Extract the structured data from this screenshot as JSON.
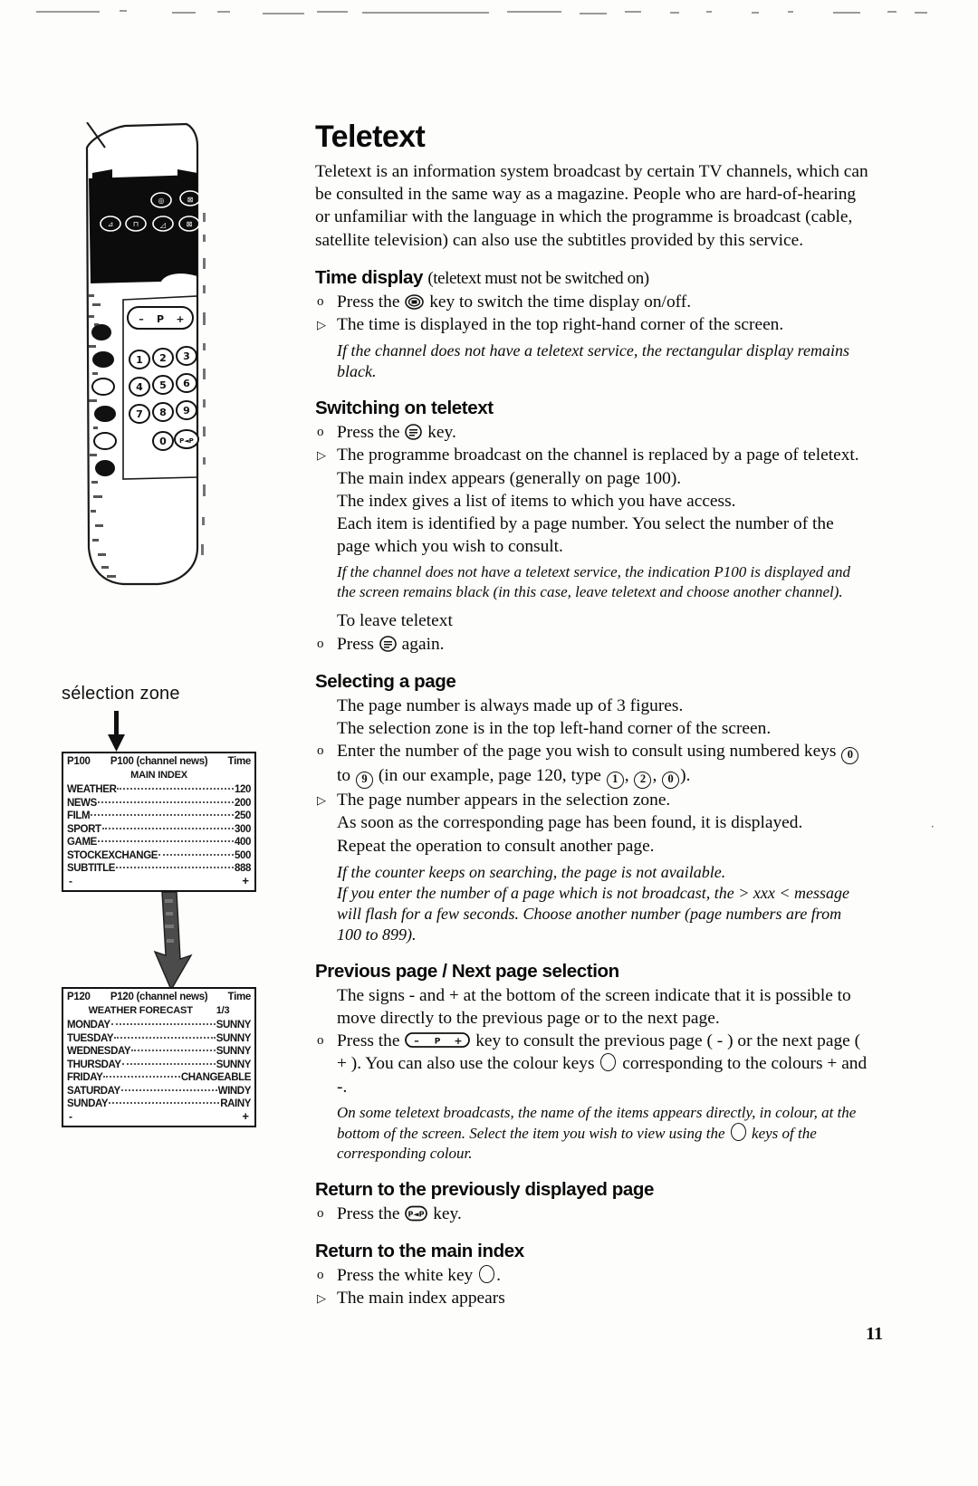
{
  "document": {
    "title": "Teletext",
    "page_number": "11",
    "intro": "Teletext is an information system broadcast by certain TV channels, which can be consulted in the same way as a magazine. People who are hard-of-hearing or unfamiliar with the language in which the programme is broadcast (cable, satellite television) can also use the subtitles provided by this service."
  },
  "sections": {
    "time_display": {
      "heading": "Time display",
      "heading_note": "(teletext must not be switched on)",
      "bullet_press_pre": "Press the",
      "bullet_press_post": "key to switch the time display on/off.",
      "result": "The time is displayed in the top right-hand corner of the screen.",
      "note": "If the channel does not have a teletext service, the rectangular display remains black."
    },
    "switching_on": {
      "heading": "Switching on teletext",
      "bullet_press_pre": "Press the",
      "bullet_press_post": "key.",
      "result_1": "The programme broadcast on the channel is replaced by a page of teletext. The main index appears (generally on page 100).",
      "result_2": "The index gives a list of items to which you have access.",
      "result_3": "Each item is identified by a page number. You select the number of the page which you wish to consult.",
      "note": "If the channel does not have a teletext service, the indication P100 is displayed and the screen remains black (in this case, leave teletext and choose another channel).",
      "leave_label": "To leave teletext",
      "leave_pre": "Press",
      "leave_post": "again."
    },
    "selecting_page": {
      "heading": "Selecting a page",
      "line_1": "The page number is always made up of 3 figures.",
      "line_2": "The selection zone is in the top left-hand corner of the screen.",
      "bullet_pre": "Enter the number of the page you wish to consult using numbered keys",
      "bullet_mid": "to",
      "bullet_post": "(in our example, page 120, type",
      "bullet_end": ").",
      "key_from": "0",
      "key_to": "9",
      "example_keys": [
        "1",
        "2",
        "0"
      ],
      "result_1": "The page number appears in the selection zone.",
      "result_2": "As soon as the corresponding page has been found, it is displayed.",
      "result_3": "Repeat the operation to consult another page.",
      "note_1": "If the counter keeps on searching, the page is not available.",
      "note_2": "If you enter the number of a page which is not broadcast, the > xxx < message will flash for a few seconds. Choose another number (page numbers are from 100 to 899)."
    },
    "prev_next": {
      "heading": "Previous page / Next page selection",
      "line_1": "The signs - and + at the bottom of the screen indicate that it is possible to move directly to the previous page or to the next page.",
      "bullet_pre": "Press the",
      "bullet_mid": "key to consult the previous page ( - ) or the next page ( + ). You can also use the colour keys",
      "bullet_post": "corresponding to the colours + and -.",
      "note_pre": "On some teletext broadcasts, the name of the items appears directly, in colour, at the bottom of the screen. Select the item you wish to view using the",
      "note_post": "keys of the corresponding colour."
    },
    "return_previous": {
      "heading": "Return to the previously displayed page",
      "bullet_pre": "Press the",
      "bullet_post": "key."
    },
    "return_index": {
      "heading": "Return to the main index",
      "bullet_pre": "Press the white key",
      "bullet_post": ".",
      "result": "The main  index appears"
    }
  },
  "illustration": {
    "selection_zone_caption": "sélection zone",
    "remote": {
      "keypad": [
        "1",
        "2",
        "3",
        "4",
        "5",
        "6",
        "7",
        "8",
        "9",
        "0"
      ],
      "pp_key_label": "P◄P",
      "rocker_minus": "–",
      "rocker_p": "P",
      "rocker_plus": "+"
    },
    "screen_main_index": {
      "header_left": "P100",
      "header_mid": "P100 (channel news)",
      "header_right": "Time",
      "title": "MAIN INDEX",
      "rows": [
        {
          "name": "WEATHER",
          "value": "120"
        },
        {
          "name": "NEWS",
          "value": "200"
        },
        {
          "name": "FILM",
          "value": "250"
        },
        {
          "name": "SPORT",
          "value": "300"
        },
        {
          "name": "GAME",
          "value": "400"
        },
        {
          "name": "STOCKEXCHANGE",
          "value": "500"
        },
        {
          "name": "SUBTITLE",
          "value": "888"
        }
      ],
      "footer_left": "-",
      "footer_right": "+"
    },
    "screen_weather": {
      "header_left": "P120",
      "header_mid": "P120 (channel news)",
      "header_right": "Time",
      "title": "WEATHER FORECAST",
      "title_page": "1/3",
      "rows": [
        {
          "name": "MONDAY",
          "value": "SUNNY"
        },
        {
          "name": "TUESDAY",
          "value": "SUNNY"
        },
        {
          "name": "WEDNESDAY",
          "value": "SUNNY"
        },
        {
          "name": "THURSDAY",
          "value": "SUNNY"
        },
        {
          "name": "FRIDAY",
          "value": "CHANGEABLE"
        },
        {
          "name": "SATURDAY",
          "value": "WINDY"
        },
        {
          "name": "SUNDAY",
          "value": "RAINY"
        }
      ],
      "footer_left": "-",
      "footer_right": "+"
    }
  }
}
